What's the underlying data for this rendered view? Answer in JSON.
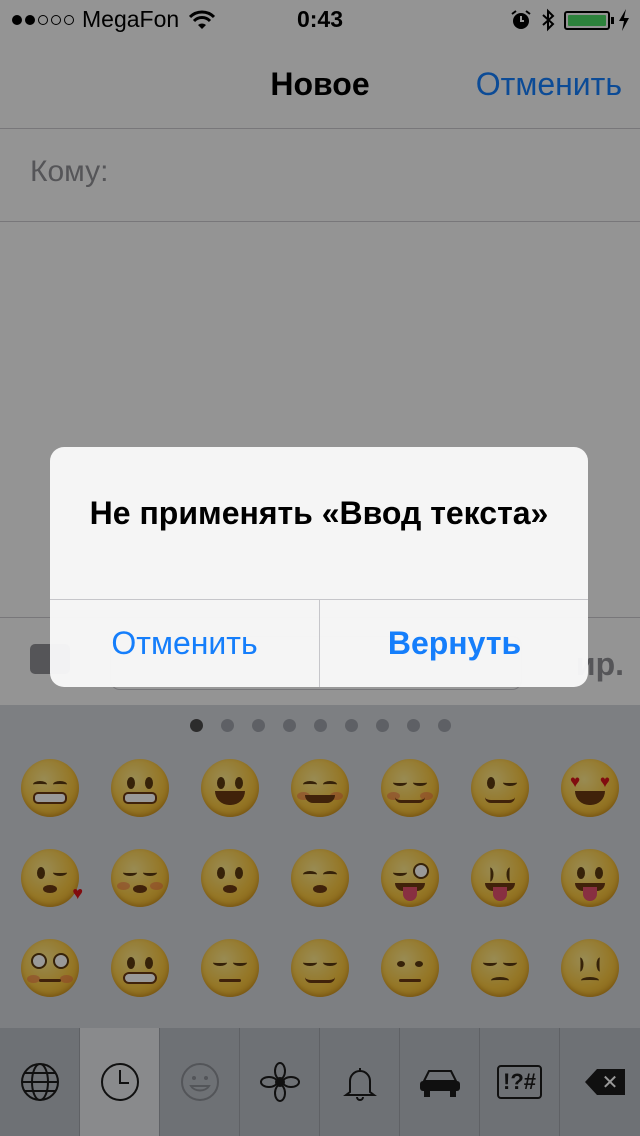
{
  "status_bar": {
    "carrier": "MegaFon",
    "time": "0:43",
    "signal_bars_filled": 2,
    "signal_bars_total": 5,
    "battery_level": 1.0,
    "battery_color": "#4cd964",
    "icons": [
      "wifi-icon",
      "alarm-clock-icon",
      "bluetooth-icon",
      "battery-icon",
      "charging-bolt-icon"
    ]
  },
  "nav": {
    "title": "Новое",
    "cancel_label": "Отменить"
  },
  "compose": {
    "to_label": "Кому:",
    "send_label_partial": "ир."
  },
  "alert": {
    "title": "Не применять «Ввод текста»",
    "cancel_label": "Отменить",
    "confirm_label": "Вернуть"
  },
  "keyboard": {
    "page_count": 9,
    "active_page": 1,
    "categories": [
      "globe-icon",
      "recent-clock-icon",
      "smiley-icon",
      "flower-icon",
      "bell-icon",
      "car-icon",
      "symbols-icon"
    ],
    "symbols_label": "!?#",
    "active_category": "smiley-icon",
    "emoji_rows": [
      [
        "grinning-face",
        "grinning-face-smiling-eyes",
        "smiling-face-open-mouth",
        "smiling-face-blush",
        "relaxed-face",
        "winking-face",
        "heart-eyes-face"
      ],
      [
        "face-blowing-kiss",
        "kissing-closed-eyes",
        "kissing-face",
        "kissing-smiling-eyes",
        "winking-tongue-face",
        "squinting-tongue-face",
        "tongue-face"
      ],
      [
        "flushed-face",
        "grimacing-face",
        "pensive-face",
        "relieved-face",
        "unamused-face",
        "disappointed-face",
        "persevering-face"
      ]
    ],
    "accent_color": "#157efb"
  }
}
